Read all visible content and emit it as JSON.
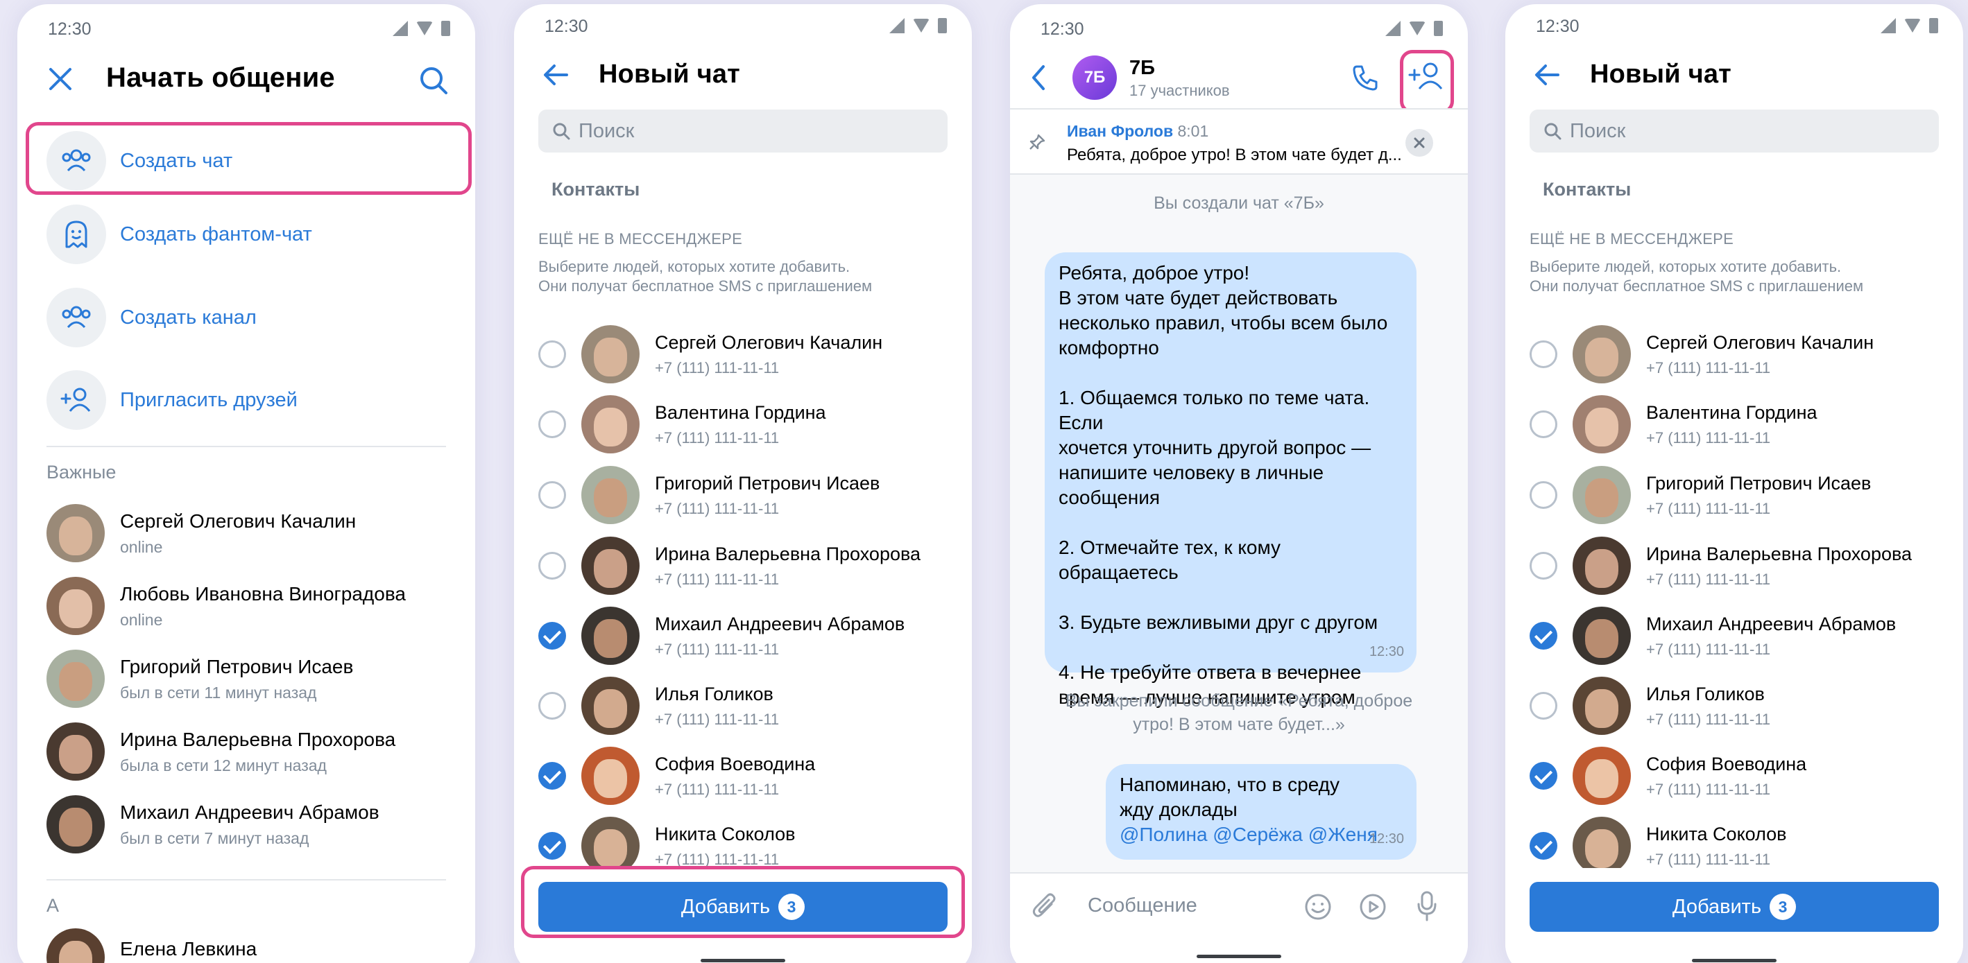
{
  "status_time": "12:30",
  "screen1": {
    "title": "Начать общение",
    "menu": [
      {
        "label": "Создать чат",
        "icon": "users-icon"
      },
      {
        "label": "Создать фантом-чат",
        "icon": "ghost-icon"
      },
      {
        "label": "Создать канал",
        "icon": "users-icon"
      },
      {
        "label": "Пригласить друзей",
        "icon": "add-user-icon"
      }
    ],
    "section_important": "Важные",
    "important": [
      {
        "name": "Сергей Олегович Качалин",
        "status": "online"
      },
      {
        "name": "Любовь Ивановна Виноградова",
        "status": "online"
      },
      {
        "name": "Григорий Петрович Исаев",
        "status": "был в сети 11 минут назад"
      },
      {
        "name": "Ирина Валерьевна Прохорова",
        "status": "была в сети 12 минут назад"
      },
      {
        "name": "Михаил Андреевич Абрамов",
        "status": "был в сети 7 минут назад"
      }
    ],
    "section_a": "А",
    "contact_a": {
      "name": "Елена Левкина"
    }
  },
  "newchat": {
    "title": "Новый чат",
    "search_placeholder": "Поиск",
    "contacts_label": "Контакты",
    "not_in_messenger": "ЕЩЁ НЕ В МЕССЕНДЖЕРЕ",
    "hint_line1": "Выберите людей, которых хотите добавить.",
    "hint_line2": "Они получат бесплатное  SMS с приглашением",
    "contacts": [
      {
        "name": "Сергей Олегович Качалин",
        "phone": "+7 (111) 111-11-11",
        "checked": false
      },
      {
        "name": "Валентина Гордина",
        "phone": "+7 (111) 111-11-11",
        "checked": false
      },
      {
        "name": "Григорий Петрович Исаев",
        "phone": "+7 (111) 111-11-11",
        "checked": false
      },
      {
        "name": "Ирина Валерьевна Прохорова",
        "phone": "+7 (111) 111-11-11",
        "checked": false
      },
      {
        "name": "Михаил  Андреевич Абрамов",
        "phone": "+7 (111) 111-11-11",
        "checked": true
      },
      {
        "name": "Илья Голиков",
        "phone": "+7 (111) 111-11-11",
        "checked": false
      },
      {
        "name": "София Воеводина",
        "phone": "+7 (111) 111-11-11",
        "checked": true
      },
      {
        "name": "Никита Соколов",
        "phone": "+7 (111) 111-11-11",
        "checked": true
      }
    ],
    "add_label": "Добавить",
    "add_count": "3"
  },
  "chat": {
    "name": "7Б",
    "avatar_text": "7Б",
    "members": "17 участников",
    "pinned_author": "Иван Фролов",
    "pinned_time": "8:01",
    "pinned_text": "Ребята, доброе утро! В этом чате будет д...",
    "created_msg": "Вы создали чат «7Б»",
    "msg1_lines": [
      "Ребята, доброе утро!",
      "В этом чате будет действовать",
      "несколько правил, чтобы всем было",
      "комфортно",
      "",
      "1. Общаемся только по теме чата. Если",
      "хочется уточнить другой вопрос —",
      "напишите человеку в личные",
      "сообщения",
      "",
      "2. Отмечайте тех, к кому обращаетесь",
      "",
      "3. Будьте вежливыми друг с другом",
      "",
      "4. Не требуйте ответа в вечернее",
      "время — лучше напишите утром"
    ],
    "msg1_time": "12:30",
    "pinned_notice_line1": "Вы закрепили сообщение «Ребята, доброе",
    "pinned_notice_line2": "утро! В этом чате будет...»",
    "msg2_line1": "Напоминаю, что в среду",
    "msg2_line2": "жду доклады",
    "msg2_mentions": "@Полина @Серёжа @Женя",
    "msg2_time": "12:30",
    "composer_placeholder": "Сообщение"
  },
  "colors": {
    "accent": "#2a7ad8",
    "highlight": "#e1468c",
    "bubble": "#cce4ff"
  }
}
